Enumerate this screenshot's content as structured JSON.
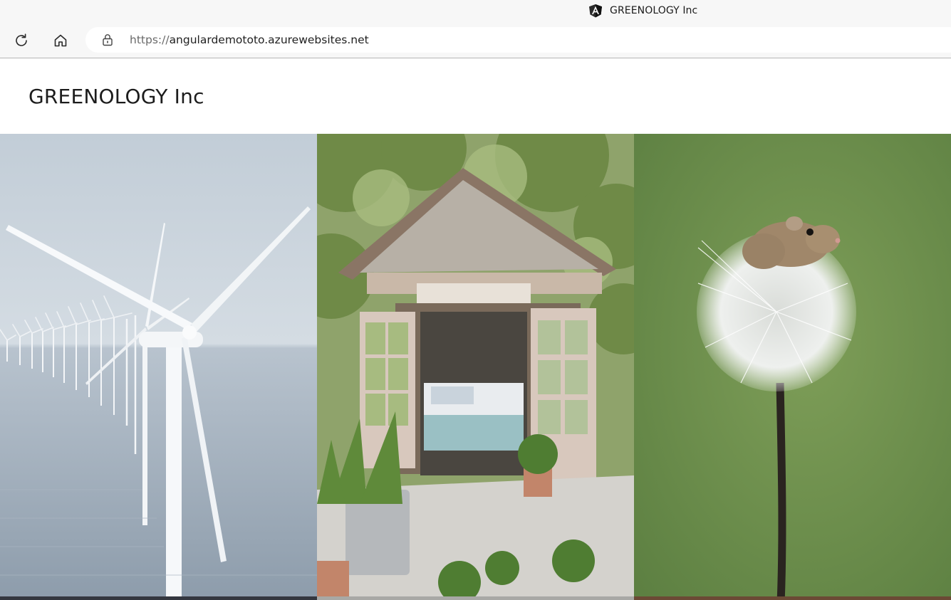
{
  "browser": {
    "tab": {
      "title": "GREENOLOGY Inc",
      "favicon": "angular-icon"
    },
    "address": {
      "scheme": "https://",
      "host": "angulardemototo.azurewebsites.net"
    },
    "buttons": {
      "refresh": "refresh-icon",
      "home": "home-icon",
      "site_info": "lock-icon"
    }
  },
  "page": {
    "brand": "GREENOLOGY Inc",
    "gallery": [
      {
        "subject": "wind turbines offshore"
      },
      {
        "subject": "glass garden cottage"
      },
      {
        "subject": "harvest mouse on dandelion"
      }
    ]
  },
  "colors": {
    "chrome_bg": "#f7f7f7",
    "text": "#1c1c1c",
    "turbine_sky": "#c9d3dc",
    "sea": "#9eabb8",
    "foliage": "#6d8a4c",
    "dandelion_bg": "#6b8f48"
  }
}
